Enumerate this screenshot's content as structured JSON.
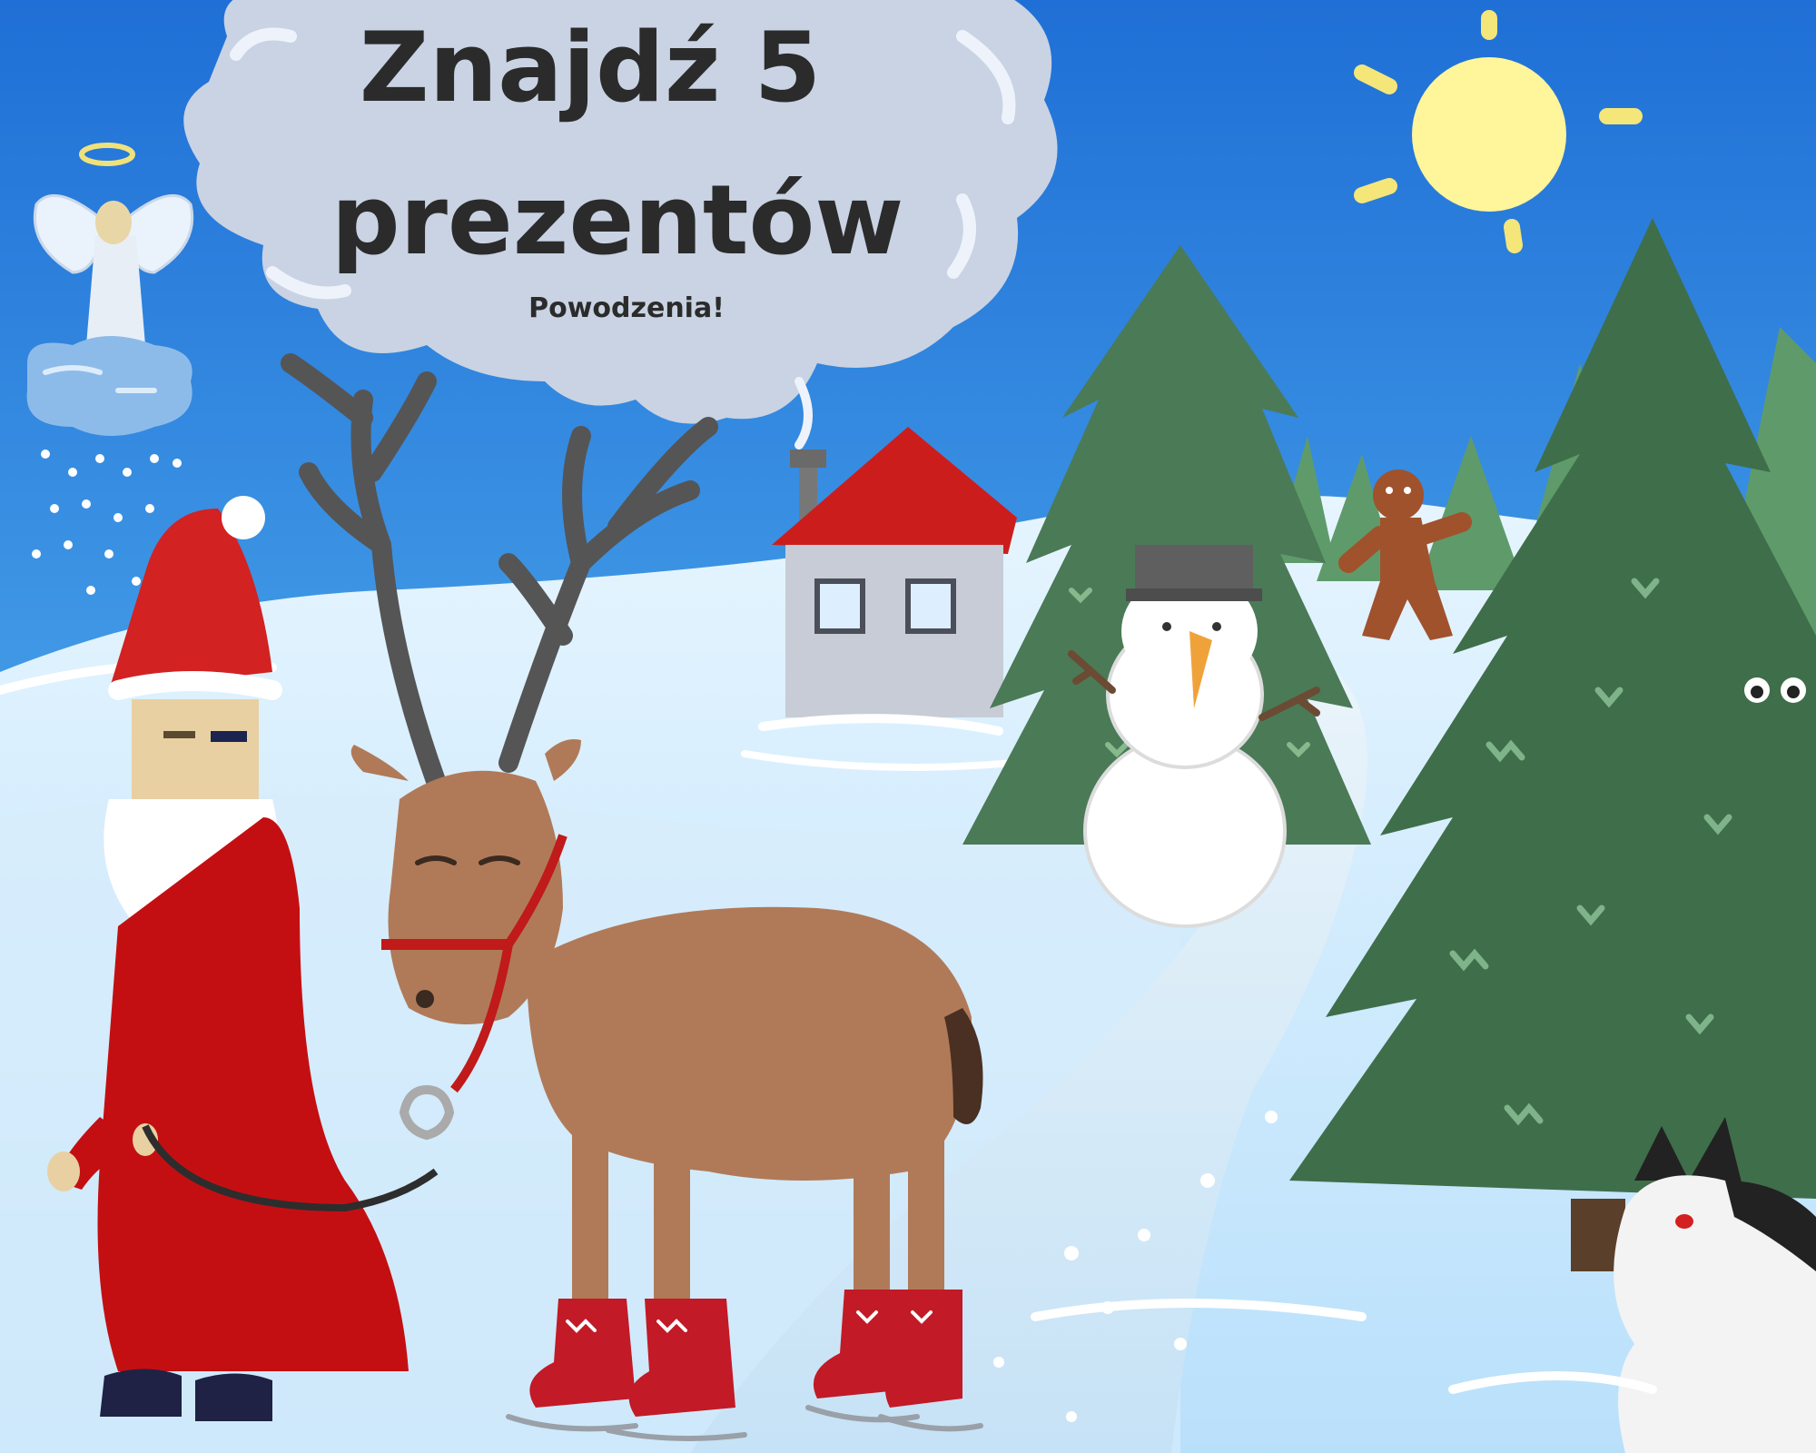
{
  "game": {
    "title_line1": "Znajdź 5",
    "title_line2": "prezentów",
    "subtitle": "Powodzenia!",
    "gifts_to_find": 5
  },
  "colors": {
    "sky_top": "#2a7bd8",
    "sky_bottom": "#8fd0f2",
    "snow": "#d8efff",
    "tree_green": "#3f6e4a",
    "santa_red": "#c01f1f",
    "reindeer_brown": "#b07a58",
    "sun": "#fff59a"
  }
}
